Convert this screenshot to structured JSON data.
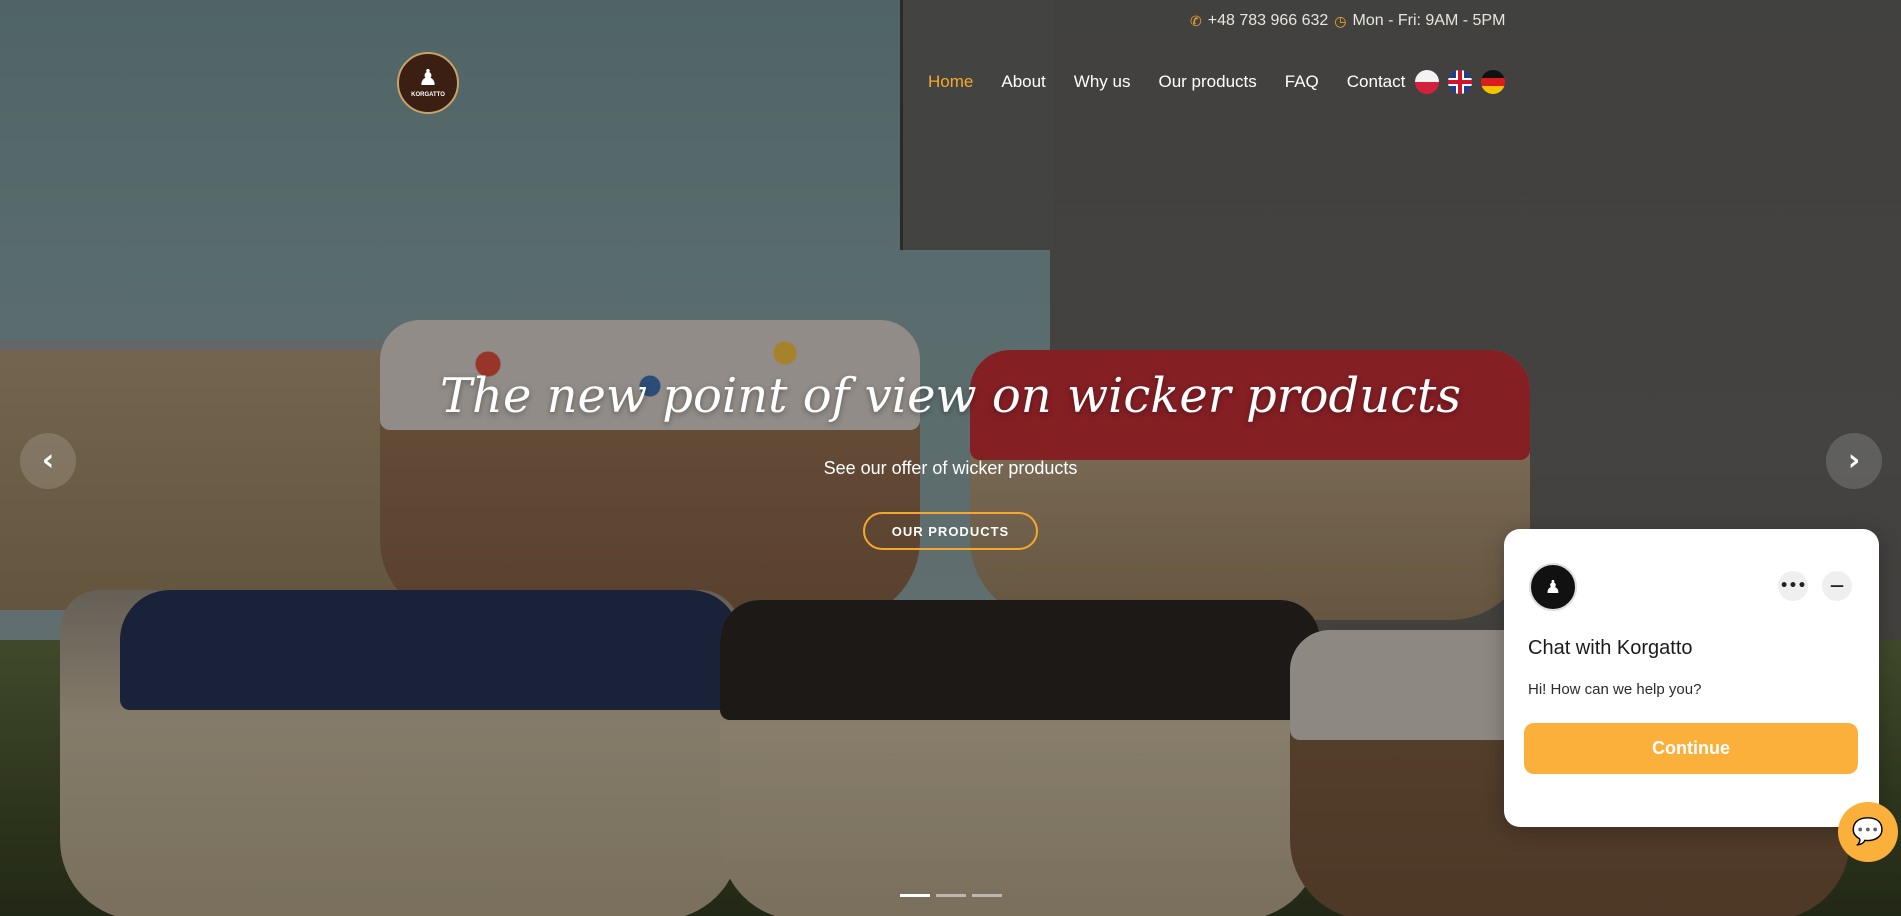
{
  "topbar": {
    "phone_icon": "phone-icon",
    "phone": "+48 783 966 632",
    "clock_icon": "clock-icon",
    "hours": "Mon - Fri: 9AM - 5PM"
  },
  "logo": {
    "text": "KORGATTO"
  },
  "nav": {
    "items": [
      {
        "label": "Home",
        "active": true
      },
      {
        "label": "About"
      },
      {
        "label": "Why us"
      },
      {
        "label": "Our products"
      },
      {
        "label": "FAQ"
      },
      {
        "label": "Contact"
      }
    ],
    "languages": [
      "pl-flag-icon",
      "en-flag-icon",
      "de-flag-icon"
    ]
  },
  "hero": {
    "title": "The new point of view on wicker products",
    "subtitle": "See our offer of wicker products",
    "button": "OUR PRODUCTS",
    "slides_total": 3,
    "slide_active": 1
  },
  "chat": {
    "title": "Chat with Korgatto",
    "message": "Hi! How can we help you?",
    "continue": "Continue",
    "more_icon": "more-icon",
    "minimize_icon": "minimize-icon"
  },
  "colors": {
    "accent": "#f5a82d",
    "chat_button": "#fbb03b"
  }
}
